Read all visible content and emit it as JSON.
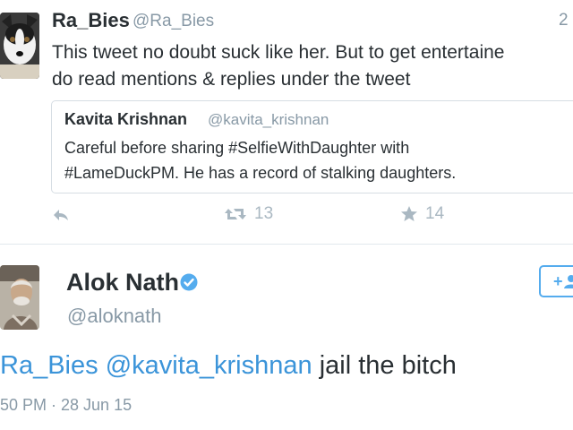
{
  "tweet1": {
    "name": "Ra_Bies",
    "handle": "@Ra_Bies",
    "time": "2",
    "text_line1": "This tweet no doubt suck like her. But to get entertaine",
    "text_line2": "do read mentions & replies under the tweet",
    "quoted": {
      "name": "Kavita Krishnan",
      "handle": "@kavita_krishnan",
      "text_line1": "Careful before sharing #SelfieWithDaughter with",
      "text_line2": "#LameDuckPM. He has a record of stalking daughters."
    },
    "actions": {
      "reply_icon": "reply-icon",
      "retweet_icon": "retweet-icon",
      "retweet_count": "13",
      "favorite_icon": "star-icon",
      "favorite_count": "14"
    }
  },
  "tweet2": {
    "name": "Alok Nath",
    "verified_icon": "verified-badge-icon",
    "handle": "@aloknath",
    "follow_label": "+",
    "follow_icon": "user-icon",
    "mention1": "Ra_Bies",
    "mention2": "@kavita_krishnan",
    "text_rest": "jail the bitch",
    "meta": "50 PM · 28 Jun 15"
  },
  "colors": {
    "link": "#3b94d9",
    "verified": "#55acee",
    "muted": "#8899a6",
    "action_gray": "#aab8c2",
    "text": "#292f33"
  }
}
